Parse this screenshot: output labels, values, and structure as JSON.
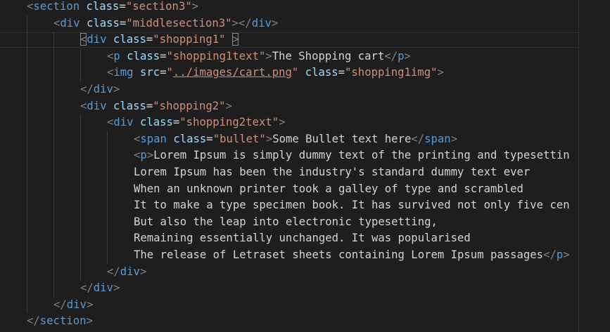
{
  "editor": {
    "language": "html",
    "colors": {
      "background": "#1e1e1e",
      "tag": "#569cd6",
      "attribute": "#9cdcfe",
      "string": "#ce9178",
      "text": "#d4d4d4",
      "punctuation": "#808080"
    },
    "lines": [
      {
        "indent": 1,
        "tokens": [
          {
            "t": "<",
            "k": "punct"
          },
          {
            "t": "section",
            "k": "tag"
          },
          {
            "t": " "
          },
          {
            "t": "class",
            "k": "attr"
          },
          {
            "t": "=",
            "k": "eq"
          },
          {
            "t": "\"section3\"",
            "k": "str"
          },
          {
            "t": ">",
            "k": "punct"
          }
        ]
      },
      {
        "indent": 2,
        "tokens": [
          {
            "t": "<",
            "k": "punct"
          },
          {
            "t": "div",
            "k": "tag"
          },
          {
            "t": " "
          },
          {
            "t": "class",
            "k": "attr"
          },
          {
            "t": "=",
            "k": "eq"
          },
          {
            "t": "\"middlesection3\"",
            "k": "str"
          },
          {
            "t": "></",
            "k": "punct"
          },
          {
            "t": "div",
            "k": "tag"
          },
          {
            "t": ">",
            "k": "punct"
          }
        ]
      },
      {
        "indent": 3,
        "tokens": [
          {
            "t": "<",
            "k": "punct",
            "box": true
          },
          {
            "t": "div",
            "k": "tag"
          },
          {
            "t": " "
          },
          {
            "t": "class",
            "k": "attr"
          },
          {
            "t": "=",
            "k": "eq"
          },
          {
            "t": "\"shopping1\"",
            "k": "str"
          },
          {
            "t": " "
          },
          {
            "t": ">",
            "k": "punct",
            "box": true
          }
        ]
      },
      {
        "indent": 4,
        "tokens": [
          {
            "t": "<",
            "k": "punct"
          },
          {
            "t": "p",
            "k": "tag"
          },
          {
            "t": " "
          },
          {
            "t": "class",
            "k": "attr"
          },
          {
            "t": "=",
            "k": "eq"
          },
          {
            "t": "\"shopping1text\"",
            "k": "str"
          },
          {
            "t": ">",
            "k": "punct"
          },
          {
            "t": "The Shopping cart",
            "k": "text"
          },
          {
            "t": "</",
            "k": "punct"
          },
          {
            "t": "p",
            "k": "tag"
          },
          {
            "t": ">",
            "k": "punct"
          }
        ]
      },
      {
        "indent": 4,
        "tokens": [
          {
            "t": "<",
            "k": "punct"
          },
          {
            "t": "img",
            "k": "tag"
          },
          {
            "t": " "
          },
          {
            "t": "src",
            "k": "attr"
          },
          {
            "t": "=",
            "k": "eq"
          },
          {
            "t": "\"",
            "k": "str"
          },
          {
            "t": "../images/cart.png",
            "k": "str",
            "link": true
          },
          {
            "t": "\"",
            "k": "str"
          },
          {
            "t": " "
          },
          {
            "t": "class",
            "k": "attr"
          },
          {
            "t": "=",
            "k": "eq"
          },
          {
            "t": "\"shopping1img\"",
            "k": "str"
          },
          {
            "t": ">",
            "k": "punct"
          }
        ]
      },
      {
        "indent": 3,
        "tokens": [
          {
            "t": "</",
            "k": "punct"
          },
          {
            "t": "div",
            "k": "tag"
          },
          {
            "t": ">",
            "k": "punct"
          }
        ]
      },
      {
        "indent": 3,
        "tokens": [
          {
            "t": "<",
            "k": "punct"
          },
          {
            "t": "div",
            "k": "tag"
          },
          {
            "t": " "
          },
          {
            "t": "class",
            "k": "attr"
          },
          {
            "t": "=",
            "k": "eq"
          },
          {
            "t": "\"shopping2\"",
            "k": "str"
          },
          {
            "t": ">",
            "k": "punct"
          }
        ]
      },
      {
        "indent": 4,
        "tokens": [
          {
            "t": "<",
            "k": "punct"
          },
          {
            "t": "div",
            "k": "tag"
          },
          {
            "t": " "
          },
          {
            "t": "class",
            "k": "attr"
          },
          {
            "t": "=",
            "k": "eq"
          },
          {
            "t": "\"shopping2text\"",
            "k": "str"
          },
          {
            "t": ">",
            "k": "punct"
          }
        ]
      },
      {
        "indent": 5,
        "tokens": [
          {
            "t": "<",
            "k": "punct"
          },
          {
            "t": "span",
            "k": "tag"
          },
          {
            "t": " "
          },
          {
            "t": "class",
            "k": "attr"
          },
          {
            "t": "=",
            "k": "eq"
          },
          {
            "t": "\"bullet\"",
            "k": "str"
          },
          {
            "t": ">",
            "k": "punct"
          },
          {
            "t": "Some Bullet text here",
            "k": "text"
          },
          {
            "t": "</",
            "k": "punct"
          },
          {
            "t": "span",
            "k": "tag"
          },
          {
            "t": ">",
            "k": "punct"
          }
        ]
      },
      {
        "indent": 5,
        "tokens": [
          {
            "t": "<",
            "k": "punct"
          },
          {
            "t": "p",
            "k": "tag"
          },
          {
            "t": ">",
            "k": "punct"
          },
          {
            "t": "Lorem Ipsum is simply dummy text of the printing and typesettin",
            "k": "text"
          }
        ]
      },
      {
        "indent": 5,
        "tokens": [
          {
            "t": "Lorem Ipsum has been the industry's standard dummy text ever",
            "k": "text"
          }
        ]
      },
      {
        "indent": 5,
        "tokens": [
          {
            "t": "When an unknown printer took a galley of type and scrambled",
            "k": "text"
          }
        ]
      },
      {
        "indent": 5,
        "tokens": [
          {
            "t": "It to make a type specimen book. It has survived not only five cen",
            "k": "text"
          }
        ]
      },
      {
        "indent": 5,
        "tokens": [
          {
            "t": "But also the leap into electronic typesetting,",
            "k": "text"
          }
        ]
      },
      {
        "indent": 5,
        "tokens": [
          {
            "t": "Remaining essentially unchanged. It was popularised",
            "k": "text"
          }
        ]
      },
      {
        "indent": 5,
        "tokens": [
          {
            "t": "The release of Letraset sheets containing Lorem Ipsum passages",
            "k": "text"
          },
          {
            "t": "</",
            "k": "punct"
          },
          {
            "t": "p",
            "k": "tag"
          },
          {
            "t": ">",
            "k": "punct"
          }
        ]
      },
      {
        "indent": 4,
        "tokens": [
          {
            "t": "</",
            "k": "punct"
          },
          {
            "t": "div",
            "k": "tag"
          },
          {
            "t": ">",
            "k": "punct"
          }
        ]
      },
      {
        "indent": 3,
        "tokens": [
          {
            "t": "</",
            "k": "punct"
          },
          {
            "t": "div",
            "k": "tag"
          },
          {
            "t": ">",
            "k": "punct"
          }
        ]
      },
      {
        "indent": 2,
        "tokens": [
          {
            "t": "</",
            "k": "punct"
          },
          {
            "t": "div",
            "k": "tag"
          },
          {
            "t": ">",
            "k": "punct"
          }
        ]
      },
      {
        "indent": 1,
        "tokens": [
          {
            "t": "</",
            "k": "punct"
          },
          {
            "t": "section",
            "k": "tag"
          },
          {
            "t": ">",
            "k": "punct"
          }
        ]
      }
    ]
  }
}
